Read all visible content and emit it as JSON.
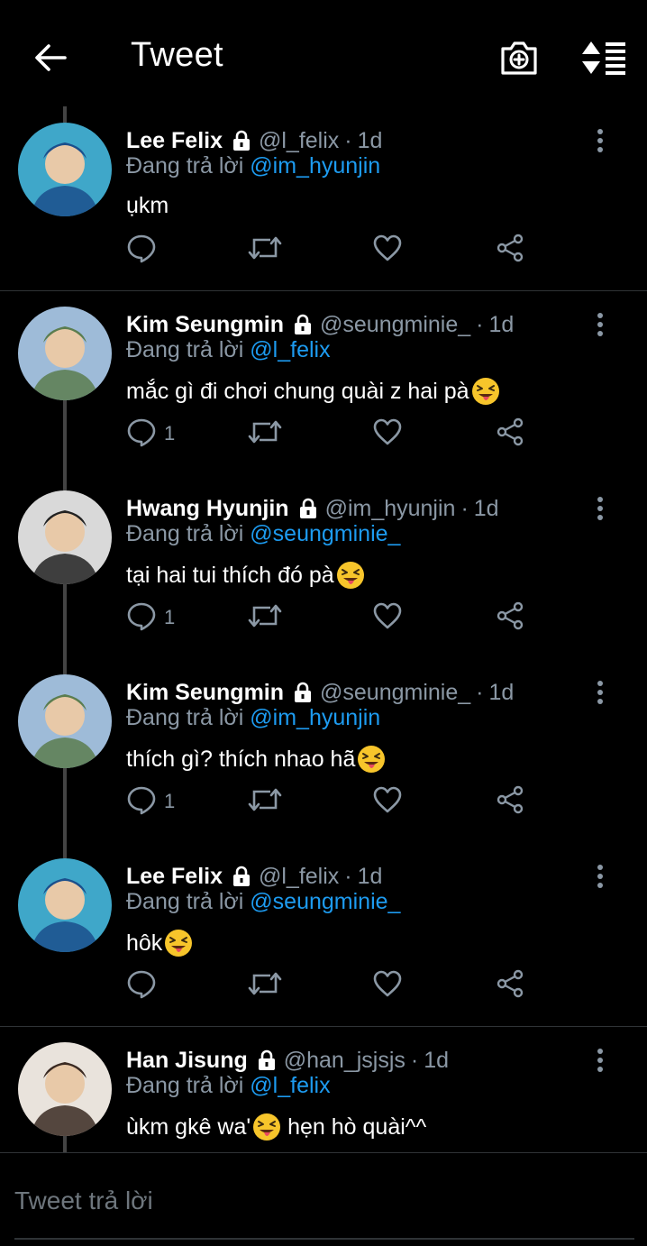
{
  "header": {
    "title": "Tweet",
    "icons": [
      "back-arrow-icon",
      "camera-add-icon",
      "sort-icon"
    ]
  },
  "tweets": [
    {
      "name": "Lee Felix",
      "handle": "@l_felix",
      "time": "1d",
      "replying_label": "Đang trả lời",
      "reply_to": "@im_hyunjin",
      "text": "ụkm",
      "emoji": "",
      "reply_count": "",
      "avatar_colors": [
        "#3fa7c9",
        "#1b4f8c"
      ]
    },
    {
      "name": "Kim Seungmin",
      "handle": "@seungminie_",
      "time": "1d",
      "replying_label": "Đang trả lời",
      "reply_to": "@l_felix",
      "text": "mắc gì đi chơi chung quài z hai pà",
      "emoji": "😝",
      "reply_count": "1",
      "avatar_colors": [
        "#9ebbd8",
        "#5b7d4f"
      ]
    },
    {
      "name": "Hwang Hyunjin",
      "handle": "@im_hyunjin",
      "time": "1d",
      "replying_label": "Đang trả lời",
      "reply_to": "@seungminie_",
      "text": "tại hai tui thích đó pà",
      "emoji": "😝",
      "reply_count": "1",
      "avatar_colors": [
        "#d9d9d9",
        "#222222"
      ]
    },
    {
      "name": "Kim Seungmin",
      "handle": "@seungminie_",
      "time": "1d",
      "replying_label": "Đang trả lời",
      "reply_to": "@im_hyunjin",
      "text": "thích gì? thích nhao hã",
      "emoji": "😝",
      "reply_count": "1",
      "avatar_colors": [
        "#9ebbd8",
        "#5b7d4f"
      ]
    },
    {
      "name": "Lee Felix",
      "handle": "@l_felix",
      "time": "1d",
      "replying_label": "Đang trả lời",
      "reply_to": "@seungminie_",
      "text": "hôk ",
      "emoji": "😝",
      "reply_count": "",
      "avatar_colors": [
        "#3fa7c9",
        "#1b4f8c"
      ]
    },
    {
      "name": "Han Jisung",
      "handle": "@han_jsjsjs",
      "time": "1d",
      "replying_label": "Đang trả lời",
      "reply_to": "@l_felix",
      "text": "ùkm gkê wa'",
      "emoji": "😝",
      "text_after": " hẹn hò quài^^",
      "reply_count": "",
      "avatar_colors": [
        "#e9e3dc",
        "#3a2a22"
      ]
    }
  ],
  "compose": {
    "placeholder": "Tweet trả lời"
  },
  "colors": {
    "background": "#000000",
    "mention": "#1d9bf0",
    "muted": "#8b98a5",
    "divider": "#2f3336"
  }
}
